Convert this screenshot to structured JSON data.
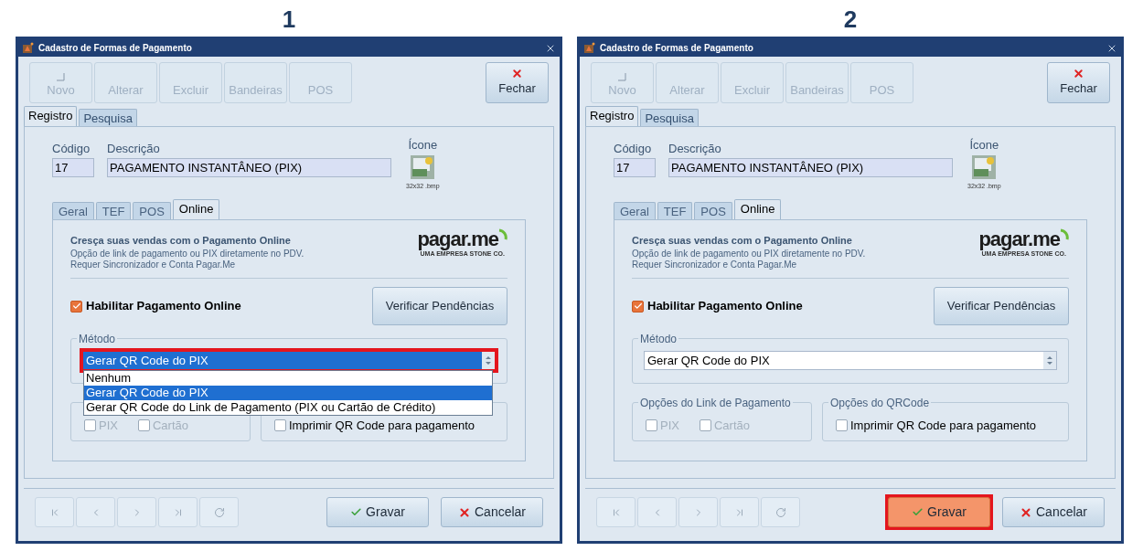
{
  "panels": [
    {
      "number": "1",
      "window": {
        "title": "Cadastro de Formas de Pagamento",
        "toolbar": [
          {
            "label": "Novo",
            "disabled": true,
            "kind": "new"
          },
          {
            "label": "Alterar",
            "disabled": true,
            "kind": "plain"
          },
          {
            "label": "Excluir",
            "disabled": true,
            "kind": "plain"
          },
          {
            "label": "Bandeiras",
            "disabled": true,
            "kind": "plain"
          },
          {
            "label": "POS",
            "disabled": true,
            "kind": "plain"
          }
        ],
        "close_button": {
          "label": "Fechar"
        },
        "tabs": [
          {
            "label": "Registro",
            "selected": true
          },
          {
            "label": "Pesquisa",
            "selected": false
          }
        ],
        "code": {
          "label": "Código",
          "value": "17"
        },
        "description": {
          "label": "Descrição",
          "value": "PAGAMENTO INSTANTÂNEO (PIX)"
        },
        "icon_field": {
          "label": "Ícone",
          "caption": "32x32 .bmp"
        },
        "subtabs": [
          {
            "label": "Geral",
            "selected": false
          },
          {
            "label": "TEF",
            "selected": false
          },
          {
            "label": "POS",
            "selected": false
          },
          {
            "label": "Online",
            "selected": true
          }
        ],
        "online": {
          "heading": "Cresça suas vendas com o Pagamento Online",
          "lines": [
            "Opção de link de pagamento ou PIX diretamente no PDV.",
            "Requer Sincronizador e Conta Pagar.Me"
          ],
          "logo": "pagar.me",
          "logo_tagline": "UMA EMPRESA STONE CO.",
          "enable": {
            "label": "Habilitar Pagamento Online",
            "checked": true
          },
          "verify_button": "Verificar Pendências",
          "method": {
            "legend": "Método",
            "value": "Gerar QR Code do PIX",
            "expanded": true,
            "highlighted": true,
            "options": [
              {
                "label": "Nenhum",
                "selected": false
              },
              {
                "label": "Gerar QR Code do PIX",
                "selected": true
              },
              {
                "label": "Gerar QR Code do Link de Pagamento (PIX ou Cartão de Crédito)",
                "selected": false
              }
            ]
          },
          "groups": [
            {
              "options": [
                {
                  "label": "PIX",
                  "checked": false,
                  "disabled": true
                },
                {
                  "label": "Cartão",
                  "checked": false,
                  "disabled": true
                }
              ]
            },
            {
              "options": [
                {
                  "label": "Imprimir QR Code para pagamento",
                  "checked": false,
                  "disabled": false
                }
              ]
            }
          ]
        },
        "save_button": {
          "label": "Gravar",
          "highlighted": false
        },
        "cancel_button": {
          "label": "Cancelar"
        }
      }
    },
    {
      "number": "2",
      "window": {
        "title": "Cadastro de Formas de Pagamento",
        "toolbar": [
          {
            "label": "Novo",
            "disabled": true,
            "kind": "new"
          },
          {
            "label": "Alterar",
            "disabled": true,
            "kind": "plain"
          },
          {
            "label": "Excluir",
            "disabled": true,
            "kind": "plain"
          },
          {
            "label": "Bandeiras",
            "disabled": true,
            "kind": "plain"
          },
          {
            "label": "POS",
            "disabled": true,
            "kind": "plain"
          }
        ],
        "close_button": {
          "label": "Fechar"
        },
        "tabs": [
          {
            "label": "Registro",
            "selected": true
          },
          {
            "label": "Pesquisa",
            "selected": false
          }
        ],
        "code": {
          "label": "Código",
          "value": "17"
        },
        "description": {
          "label": "Descrição",
          "value": "PAGAMENTO INSTANTÂNEO (PIX)"
        },
        "icon_field": {
          "label": "Ícone",
          "caption": "32x32 .bmp"
        },
        "subtabs": [
          {
            "label": "Geral",
            "selected": false
          },
          {
            "label": "TEF",
            "selected": false
          },
          {
            "label": "POS",
            "selected": false
          },
          {
            "label": "Online",
            "selected": true
          }
        ],
        "online": {
          "heading": "Cresça suas vendas com o Pagamento Online",
          "lines": [
            "Opção de link de pagamento ou PIX diretamente no PDV.",
            "Requer Sincronizador e Conta Pagar.Me"
          ],
          "logo": "pagar.me",
          "logo_tagline": "UMA EMPRESA STONE CO.",
          "enable": {
            "label": "Habilitar Pagamento Online",
            "checked": true
          },
          "verify_button": "Verificar Pendências",
          "method": {
            "legend": "Método",
            "value": "Gerar QR Code do PIX",
            "expanded": false,
            "highlighted": false
          },
          "groups": [
            {
              "legend": "Opções do Link de Pagamento",
              "options": [
                {
                  "label": "PIX",
                  "checked": false,
                  "disabled": true
                },
                {
                  "label": "Cartão",
                  "checked": false,
                  "disabled": true
                }
              ]
            },
            {
              "legend": "Opções do QRCode",
              "options": [
                {
                  "label": "Imprimir QR Code para pagamento",
                  "checked": false,
                  "disabled": false
                }
              ]
            }
          ]
        },
        "save_button": {
          "label": "Gravar",
          "highlighted": true
        },
        "cancel_button": {
          "label": "Cancelar"
        }
      }
    }
  ]
}
